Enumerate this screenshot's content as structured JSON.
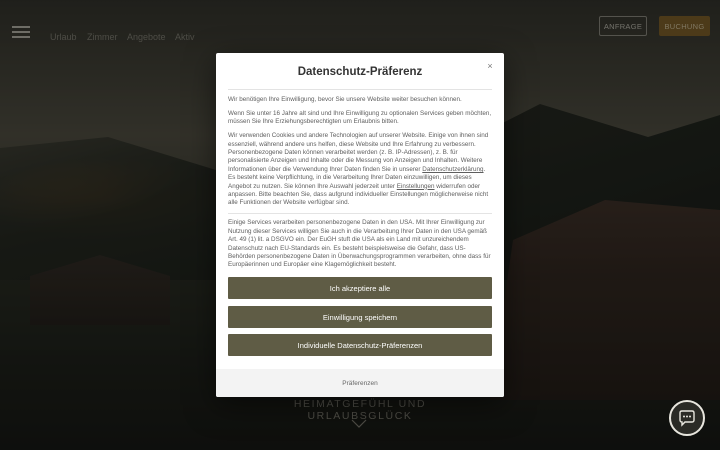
{
  "header": {
    "nav": [
      "Urlaub",
      "Zimmer",
      "Angebote",
      "Aktiv"
    ],
    "anfrage_label": "ANFRAGE",
    "buchen_label": "BUCHUNG"
  },
  "hero": {
    "tagline": "HEIMATGEFÜHL UND URLAUBSGLÜCK"
  },
  "modal": {
    "title": "Datenschutz-Präferenz",
    "close": "×",
    "p1": "Wir benötigen Ihre Einwilligung, bevor Sie unsere Website weiter besuchen können.",
    "p2": "Wenn Sie unter 16 Jahre alt sind und Ihre Einwilligung zu optionalen Services geben möchten, müssen Sie Ihre Erziehungsberechtigten um Erlaubnis bitten.",
    "p3a": "Wir verwenden Cookies und andere Technologien auf unserer Website. Einige von ihnen sind essenziell, während andere uns helfen, diese Website und Ihre Erfahrung zu verbessern. Personenbezogene Daten können verarbeitet werden (z. B. IP-Adressen), z. B. für personalisierte Anzeigen und Inhalte oder die Messung von Anzeigen und Inhalten. Weitere Informationen über die Verwendung Ihrer Daten finden Sie in unserer ",
    "p3_link1": "Datenschutzerklärung",
    "p3b": ". Es besteht keine Verpflichtung, in die Verarbeitung Ihrer Daten einzuwilligen, um dieses Angebot zu nutzen. Sie können Ihre Auswahl jederzeit unter ",
    "p3_link2": "Einstellungen",
    "p3c": " widerrufen oder anpassen. Bitte beachten Sie, dass aufgrund individueller Einstellungen möglicherweise nicht alle Funktionen der Website verfügbar sind.",
    "p4": "Einige Services verarbeiten personenbezogene Daten in den USA. Mit Ihrer Einwilligung zur Nutzung dieser Services willigen Sie auch in die Verarbeitung Ihrer Daten in den USA gemäß Art. 49 (1) lit. a DSGVO ein. Der EuGH stuft die USA als ein Land mit unzureichendem Datenschutz nach EU-Standards ein. Es besteht beispielsweise die Gefahr, dass US-Behörden personenbezogene Daten in Überwachungsprogrammen verarbeiten, ohne dass für Europäerinnen und Europäer eine Klagemöglichkeit besteht.",
    "btn_accept": "Ich akzeptiere alle",
    "btn_save": "Einwilligung speichern",
    "btn_individual": "Individuelle Datenschutz-Präferenzen",
    "footer_link": "Präferenzen"
  },
  "colors": {
    "modal_button": "#5f5c45",
    "buchen": "#8a6a2e"
  },
  "icons": {
    "menu": "hamburger-menu-icon",
    "close": "close-icon",
    "scroll": "chevron-down-icon",
    "chat": "chat-bubble-icon"
  }
}
